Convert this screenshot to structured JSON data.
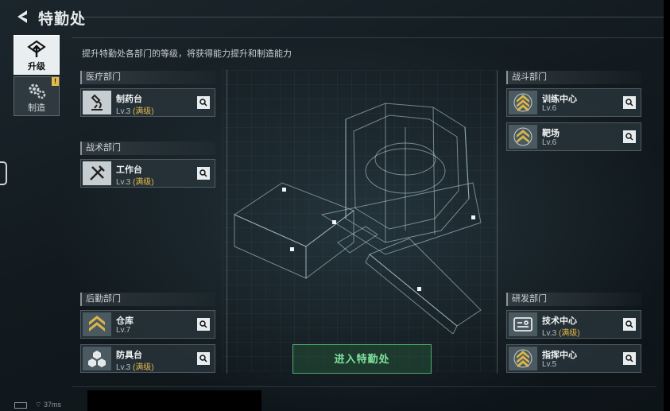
{
  "header": {
    "title": "特勤处"
  },
  "subtitle": "提升特勤处各部门的等级，将获得能力提升和制造能力",
  "side_tabs": [
    {
      "label": "升级",
      "icon": "upgrade-icon",
      "active": true
    },
    {
      "label": "制造",
      "icon": "gears-icon",
      "badge": "!"
    }
  ],
  "departments": {
    "medical": {
      "title": "医疗部门",
      "cards": [
        {
          "name": "制药台",
          "level": "Lv.3",
          "max": "(满级)",
          "icon": "microscope-icon"
        }
      ]
    },
    "tactical": {
      "title": "战术部门",
      "cards": [
        {
          "name": "工作台",
          "level": "Lv.3",
          "max": "(满级)",
          "icon": "tools-icon"
        }
      ]
    },
    "logistics": {
      "title": "后勤部门",
      "cards": [
        {
          "name": "仓库",
          "level": "Lv.7",
          "icon": "chevron-rank-icon"
        },
        {
          "name": "防具台",
          "level": "Lv.3",
          "max": "(满级)",
          "icon": "cubes-icon"
        }
      ]
    },
    "combat": {
      "title": "战斗部门",
      "cards": [
        {
          "name": "训练中心",
          "level": "Lv.6",
          "icon": "chevron-rank-icon"
        },
        {
          "name": "靶场",
          "level": "Lv.6",
          "icon": "chevron-rank-icon"
        }
      ]
    },
    "research": {
      "title": "研发部门",
      "cards": [
        {
          "name": "技术中心",
          "level": "Lv.3",
          "max": "(满级)",
          "icon": "tech-panel-icon"
        },
        {
          "name": "指挥中心",
          "level": "Lv.5",
          "icon": "chevron-rank-icon"
        }
      ]
    }
  },
  "enter_button": "进入特勤处",
  "status": {
    "ping": "37ms"
  },
  "colors": {
    "accent_green": "#4fae6f",
    "max_gold": "#e0b74c"
  }
}
